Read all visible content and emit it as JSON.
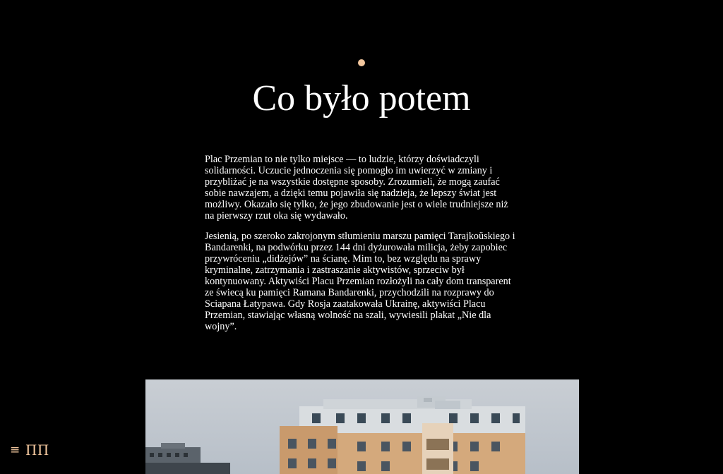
{
  "section": {
    "title": "Co było potem",
    "accent_color": "#f3c79e"
  },
  "article": {
    "paragraphs": [
      "Plac Przemian to nie tylko miejsce — to ludzie, którzy doświadczyli solidarności. Uczucie jednoczenia się pomogło im uwierzyć w zmiany i przybliżać je na wszystkie dostępne sposoby. Zrozumieli, że mogą zaufać sobie nawzajem, a dzięki temu pojawiła się nadzieja, że lepszy świat jest możliwy. Okazało się tylko, że jego zbudowanie jest o wiele trudniejsze niż na pierwszy rzut oka się wydawało.",
      "Jesienią, po szeroko zakrojonym stłumieniu marszu pamięci Tarajkoŭskiego i Bandarenki, na podwórku przez 144 dni dyżurowała milicja, żeby zapobiec przywróceniu „didżejów” na ścianę. Mim to, bez względu na sprawy kryminalne, zatrzymania i zastraszanie aktywistów, sprzeciw był kontynuowany. Aktywiści Placu Przemian rozłożyli na cały dom transparent ze świecą ku pamięci Ramana Bandarenki, przychodzili na rozprawy do Sciapana Łatypawa. Gdy Rosja zaatakowała Ukrainę, aktywiści Placu Przemian, stawiając własną wolność na szali, wywiesili plakat „Nie dla wojny”."
    ]
  },
  "nav": {
    "menu_icon": "≡",
    "logo": "ПП"
  },
  "photo": {
    "description_icon": "building-photo"
  }
}
